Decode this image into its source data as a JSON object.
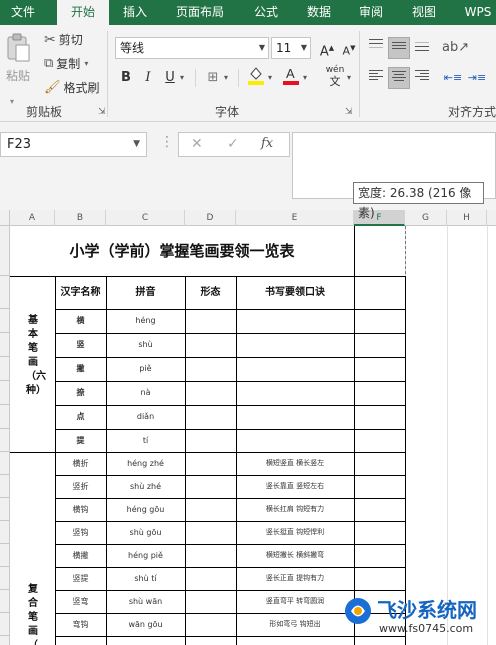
{
  "tabs": [
    "文件",
    "开始",
    "插入",
    "页面布局",
    "公式",
    "数据",
    "审阅",
    "视图",
    "WPS"
  ],
  "active_tab": "开始",
  "clipboard": {
    "paste_label": "粘贴",
    "cut_label": "剪切",
    "copy_label": "复制",
    "format_painter_label": "格式刷",
    "group_label": "剪贴板"
  },
  "font": {
    "font_name": "等线",
    "font_size": "11",
    "group_label": "字体",
    "bold": "B",
    "italic": "I",
    "underline": "U",
    "grow": "A",
    "shrink": "A",
    "phonetic": "wén",
    "format_symbol": "文"
  },
  "alignment": {
    "group_label": "对齐方式"
  },
  "formula_bar": {
    "name_box": "F23",
    "fx": "fx",
    "tooltip": "宽度: 26.38 (216 像素)"
  },
  "columns": [
    "A",
    "B",
    "C",
    "D",
    "E",
    "F",
    "G",
    "H"
  ],
  "selected_column": "F",
  "sheet": {
    "title": "小学（学前）掌握笔画要领一览表",
    "headers": [
      "汉字名称",
      "拼音",
      "形态",
      "书写要领口诀"
    ],
    "basic_group_label": "基本笔画（六种）",
    "compound_group_label": "复合笔画（",
    "basic_rows": [
      {
        "name": "横",
        "pinyin": "héng"
      },
      {
        "name": "竖",
        "pinyin": "shù"
      },
      {
        "name": "撇",
        "pinyin": "piě"
      },
      {
        "name": "捺",
        "pinyin": "nà"
      },
      {
        "name": "点",
        "pinyin": "diǎn"
      },
      {
        "name": "提",
        "pinyin": "tí"
      }
    ],
    "compound_rows": [
      {
        "name": "横折",
        "pinyin": "héng  zhé",
        "tip": "横短竖直  横长竖左"
      },
      {
        "name": "竖折",
        "pinyin": "shù  zhé",
        "tip": "竖长靠直  竖短左右"
      },
      {
        "name": "横钩",
        "pinyin": "héng    gōu",
        "tip": "横长扛肩  钩短有力"
      },
      {
        "name": "竖钩",
        "pinyin": "shù    gōu",
        "tip": "竖长挺直  钩短悍利"
      },
      {
        "name": "横撇",
        "pinyin": "héng  piě",
        "tip": "横短撇长  横斜撇弯"
      },
      {
        "name": "竖提",
        "pinyin": "shù  tí",
        "tip": "竖长正直  提钩有力"
      },
      {
        "name": "竖弯",
        "pinyin": "shù  wān",
        "tip": "竖直弯平  转弯圆润"
      },
      {
        "name": "弯钩",
        "pinyin": "wān  gōu",
        "tip": "形如弯弓  钩短出"
      }
    ]
  },
  "watermark": {
    "title": "飞沙系统网",
    "url": "www.fs0745.com"
  }
}
